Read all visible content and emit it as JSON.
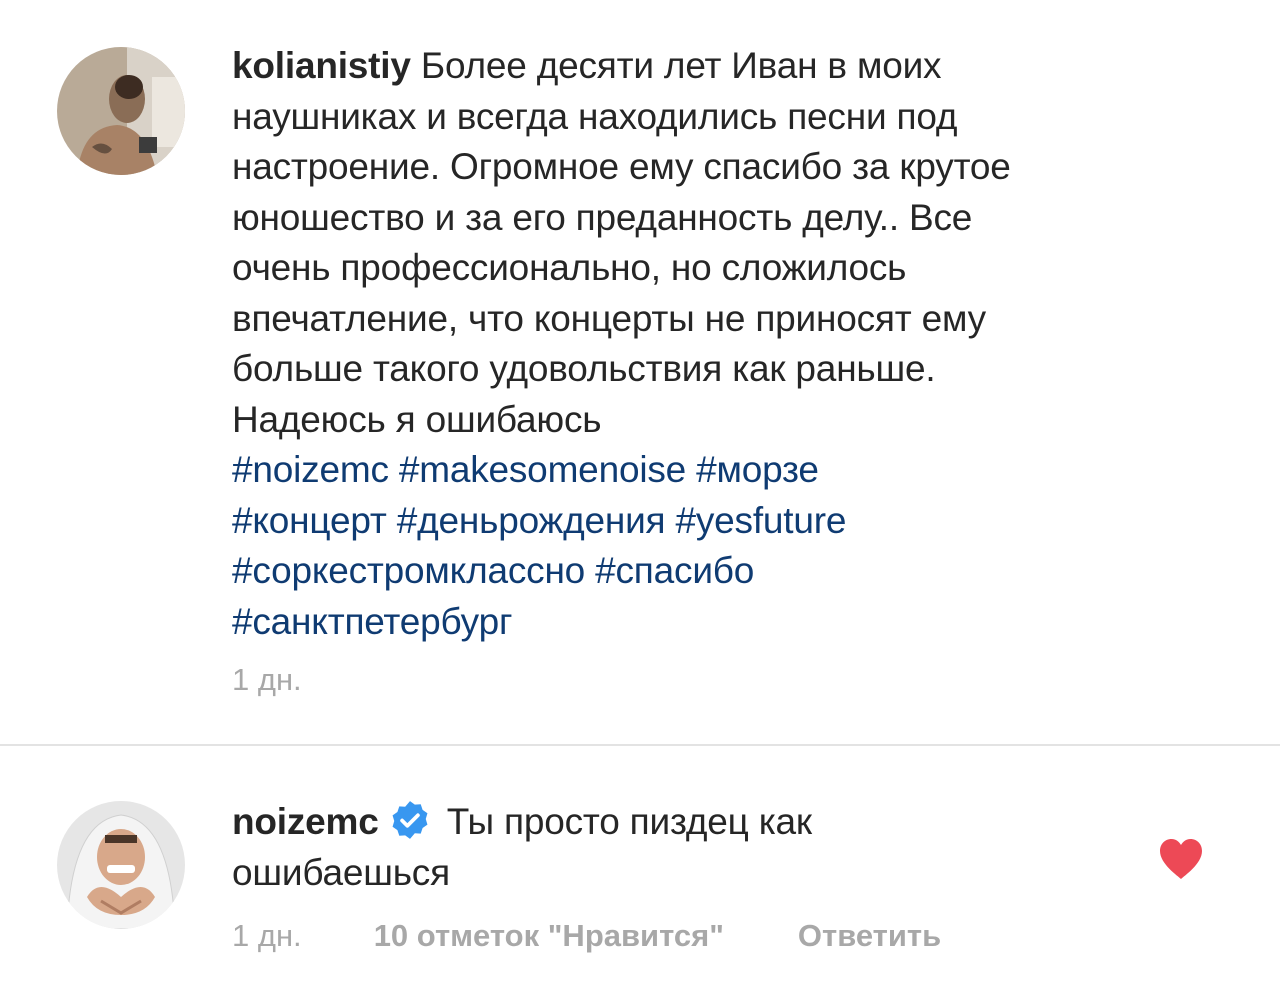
{
  "comments": [
    {
      "username": "kolianistiy",
      "lines": [
        "Более десяти лет Иван в моих",
        "наушниках и всегда находились песни под",
        "настроение. Огромное ему спасибо за крутое",
        "юношество и за его преданность делу.. Все",
        "очень профессионально, но сложилось",
        "впечатление, что концерты не приносят ему",
        "больше такого удовольствия как раньше.",
        "Надеюсь я ошибаюсь"
      ],
      "hashtag_lines": [
        "#noizemc #makesomenoise #морзе",
        "#концерт #деньрождения #yesfuture",
        "#соркестромклассно #спасибо",
        "#санктпетербург"
      ],
      "time": "1 дн."
    },
    {
      "username": "noizemc",
      "verified": true,
      "text_line1": "Ты просто пиздец как",
      "text_line2": "ошибаешься",
      "time": "1 дн.",
      "likes": "10 отметок \"Нравится\"",
      "reply": "Ответить",
      "liked": true
    }
  ],
  "colors": {
    "hashtag": "#0f3b72",
    "verified_badge": "#3897f0",
    "heart": "#ed4956",
    "meta_text": "#a8a8a8"
  },
  "icons": {
    "verified": "verified-badge-icon",
    "like": "heart-icon"
  }
}
